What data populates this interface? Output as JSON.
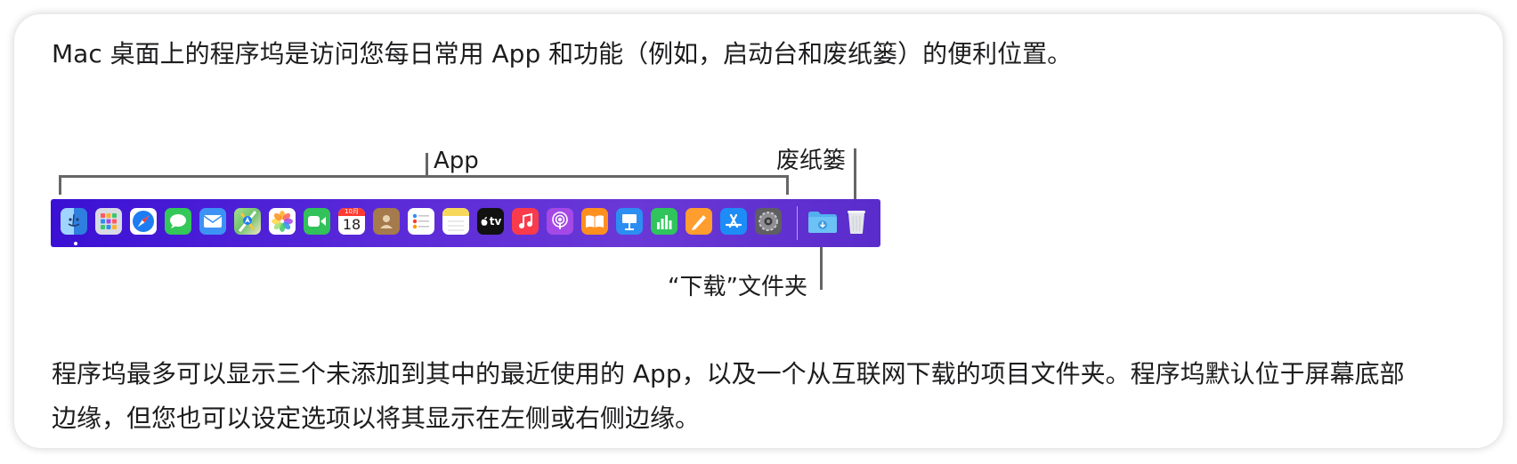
{
  "intro_text": "Mac 桌面上的程序坞是访问您每日常用 App 和功能（例如，启动台和废纸篓）的便利位置。",
  "callouts": {
    "app": "App",
    "trash": "废纸篓",
    "downloads": "“下载”文件夹"
  },
  "body_text": {
    "line1": "程序坞最多可以显示三个未添加到其中的最近使用的 App，以及一个从互联网下载的项目文件夹。程序坞默认位于屏幕底部",
    "line2": "边缘，但您也可以设定选项以将其显示在左侧或右侧边缘。"
  },
  "dock": {
    "background_color": "#4a1fd6",
    "calendar": {
      "month": "10月",
      "day": "18"
    },
    "apple_tv_text": "tv",
    "apps": [
      {
        "name": "finder-icon",
        "color": "#2e8ff0"
      },
      {
        "name": "launchpad-icon",
        "color": "#c9cbd6"
      },
      {
        "name": "safari-icon",
        "color": "#1e7cf2"
      },
      {
        "name": "messages-icon",
        "color": "#34c759"
      },
      {
        "name": "mail-icon",
        "color": "#3d93f5"
      },
      {
        "name": "maps-icon",
        "color": "#6fc26b"
      },
      {
        "name": "photos-icon",
        "color": "#ffffff"
      },
      {
        "name": "facetime-icon",
        "color": "#32c15a"
      },
      {
        "name": "calendar-icon",
        "color": "#ffffff"
      },
      {
        "name": "contacts-icon",
        "color": "#a57a4c"
      },
      {
        "name": "reminders-icon",
        "color": "#ffffff"
      },
      {
        "name": "notes-icon",
        "color": "#f7d85a"
      },
      {
        "name": "apple-tv-icon",
        "color": "#111111"
      },
      {
        "name": "music-icon",
        "color": "#fa3b4c"
      },
      {
        "name": "podcasts-icon",
        "color": "#a549e6"
      },
      {
        "name": "books-icon",
        "color": "#ff8f1f"
      },
      {
        "name": "keynote-icon",
        "color": "#2c8ef2"
      },
      {
        "name": "numbers-icon",
        "color": "#2fc45c"
      },
      {
        "name": "pages-icon",
        "color": "#ff9d2e"
      },
      {
        "name": "app-store-icon",
        "color": "#1d8cf7"
      },
      {
        "name": "system-settings-icon",
        "color": "#6e6e73"
      }
    ],
    "downloads_folder_color": "#52b0ee",
    "trash_color": "#dfe3e8"
  }
}
